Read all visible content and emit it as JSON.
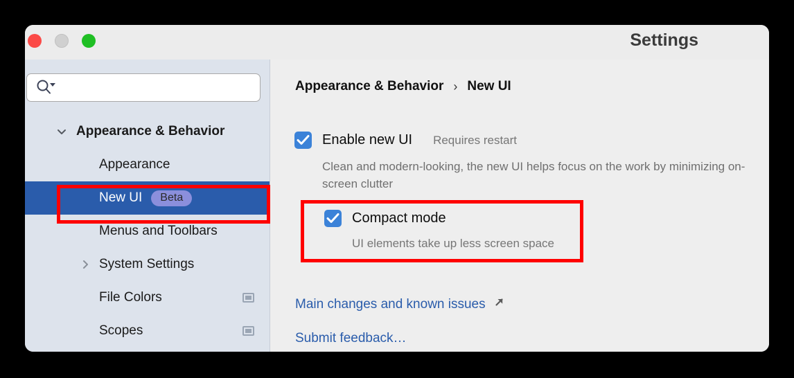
{
  "window": {
    "title": "Settings",
    "traffic_lights": [
      {
        "name": "close",
        "color": "#fb4a47"
      },
      {
        "name": "minimize",
        "color": "#d0d0d0"
      },
      {
        "name": "zoom",
        "color": "#1fbf24"
      }
    ]
  },
  "sidebar": {
    "search": {
      "value": "",
      "placeholder": "",
      "icon": "search-icon"
    },
    "items": [
      {
        "label": "Appearance & Behavior",
        "type": "group",
        "expanded": true,
        "chevron": "chevron-down-icon",
        "selected": false,
        "indicator": false
      },
      {
        "label": "Appearance",
        "type": "child",
        "selected": false,
        "indicator": false
      },
      {
        "label": "New UI",
        "type": "child",
        "selected": true,
        "badge": "Beta",
        "indicator": false
      },
      {
        "label": "Menus and Toolbars",
        "type": "child",
        "selected": false,
        "indicator": false
      },
      {
        "label": "System Settings",
        "type": "child-collapsible",
        "expanded": false,
        "chevron": "chevron-right-icon",
        "selected": false,
        "indicator": false
      },
      {
        "label": "File Colors",
        "type": "child",
        "selected": false,
        "indicator": true
      },
      {
        "label": "Scopes",
        "type": "child",
        "selected": false,
        "indicator": true
      }
    ]
  },
  "main": {
    "breadcrumb": {
      "root": "Appearance & Behavior",
      "separator": "›",
      "current": "New UI"
    },
    "enable_new_ui": {
      "label": "Enable new UI",
      "checked": true,
      "hint": "Requires restart",
      "description": "Clean and modern-looking, the new UI helps focus on the work by minimizing on-screen clutter"
    },
    "compact_mode": {
      "label": "Compact mode",
      "checked": true,
      "description": "UI elements take up less screen space"
    },
    "links": [
      {
        "label": "Main changes and known issues",
        "icon": "external-link-icon"
      },
      {
        "label": "Submit feedback…",
        "icon": null
      }
    ]
  },
  "annotations": {
    "color": "#ff0000",
    "boxes": [
      {
        "name": "new-ui-sidebar-item"
      },
      {
        "name": "compact-mode-option"
      }
    ]
  },
  "colors": {
    "selection": "#2a5cab",
    "checkbox": "#3b82d8",
    "badge_bg": "#8b8fdc",
    "sidebar_bg": "#dde3ec",
    "main_bg": "#eeeeee",
    "link": "#2a5cab",
    "annotation": "#ff0000"
  }
}
